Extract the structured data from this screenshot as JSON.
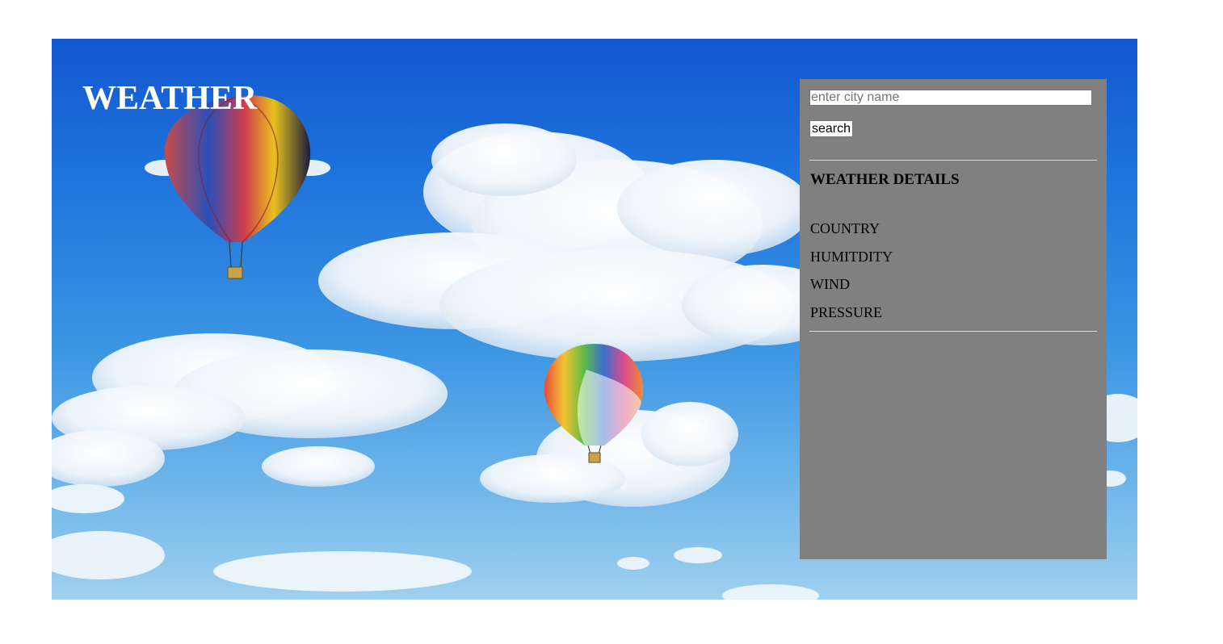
{
  "app": {
    "title": "WEATHER"
  },
  "search": {
    "placeholder": "enter city name",
    "value": "",
    "button_label": "search"
  },
  "details": {
    "heading": "WEATHER DETAILS",
    "items": [
      {
        "label": "COUNTRY"
      },
      {
        "label": "HUMITDITY"
      },
      {
        "label": "WIND"
      },
      {
        "label": "PRESSURE"
      }
    ]
  },
  "background": {
    "image": "sky-with-hot-air-balloons"
  },
  "colors": {
    "panel": "#808080",
    "sky_top": "#1257d1",
    "sky_bottom": "#9fd0ef",
    "title": "#ffffff"
  }
}
